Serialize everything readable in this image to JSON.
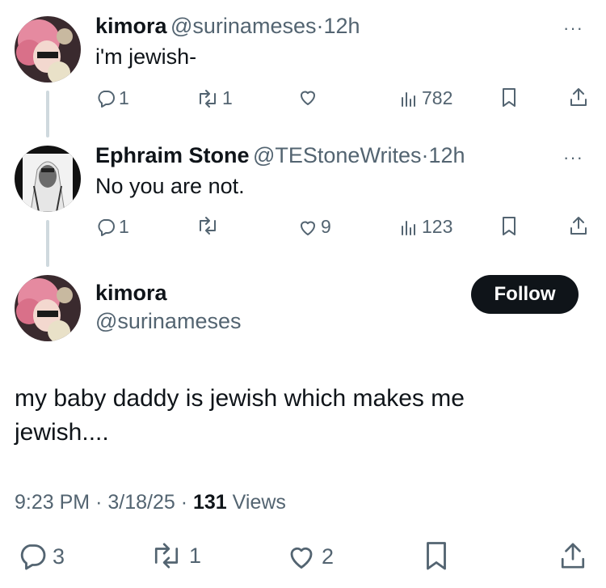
{
  "tweet1": {
    "name": "kimora",
    "handle": "@surinameses",
    "time": "12h",
    "text": "i'm jewish-",
    "replies": "1",
    "reposts": "1",
    "likes": "",
    "views": "782"
  },
  "tweet2": {
    "name": "Ephraim Stone",
    "handle": "@TEStoneWrites",
    "time": "12h",
    "text": "No you are not.",
    "replies": "1",
    "reposts": "",
    "likes": "9",
    "views": "123"
  },
  "main": {
    "name": "kimora",
    "handle": "@surinameses",
    "follow_label": "Follow",
    "text_line1": "my baby daddy is jewish which makes me",
    "text_line2": "jewish....",
    "meta_time": "9:23 PM",
    "meta_date": "3/18/25",
    "views_count": "131",
    "views_label": "Views",
    "replies": "3",
    "reposts": "1",
    "likes": "2"
  },
  "separator": "·",
  "more_glyph": "···",
  "icons": [
    "reply-icon",
    "repost-icon",
    "like-icon",
    "views-icon",
    "bookmark-icon",
    "share-icon",
    "more-icon"
  ]
}
